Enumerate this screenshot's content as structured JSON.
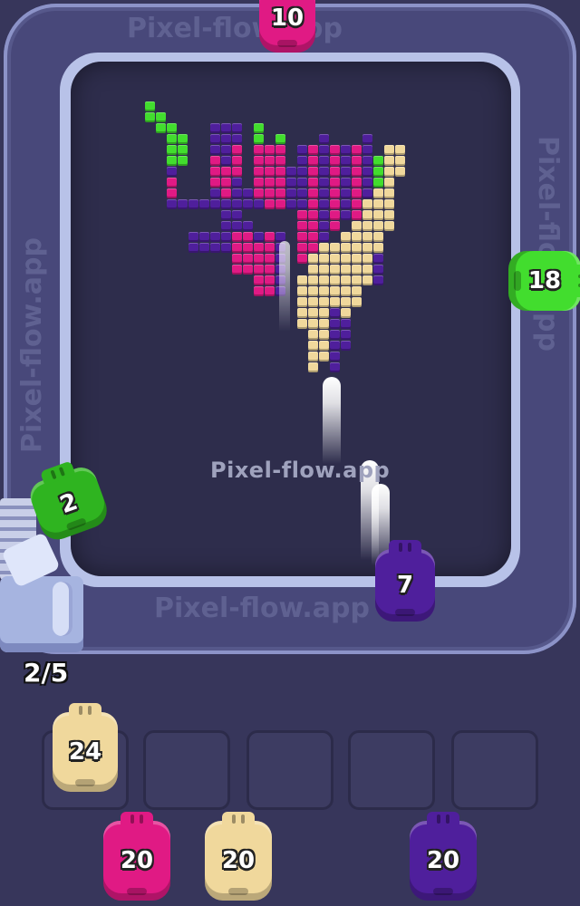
{
  "game": {
    "watermark": "Pixel-flow.app",
    "capacity": "2/5",
    "colors": {
      "magenta": "#e01a84",
      "purple": "#4f1f9c",
      "green": "#42dd2e",
      "cream": "#f0d89c",
      "background": "#37365b",
      "board": "#2e2d4c"
    }
  },
  "conveyor_pigs": [
    {
      "name": "pig-top",
      "count": "10",
      "color": "magenta"
    },
    {
      "name": "pig-right",
      "count": "18",
      "color": "green"
    },
    {
      "name": "pig-left",
      "count": "2",
      "color": "green"
    },
    {
      "name": "pig-bottom",
      "count": "7",
      "color": "purple"
    }
  ],
  "waiting_slots": [
    {
      "count": "24",
      "color": "cream"
    },
    {
      "count": "",
      "color": ""
    },
    {
      "count": "",
      "color": ""
    },
    {
      "count": "",
      "color": ""
    },
    {
      "count": "",
      "color": ""
    }
  ],
  "queue_pigs": [
    {
      "count": "20",
      "color": "magenta"
    },
    {
      "count": "20",
      "color": "cream"
    },
    {
      "count": "20",
      "color": "purple"
    }
  ]
}
